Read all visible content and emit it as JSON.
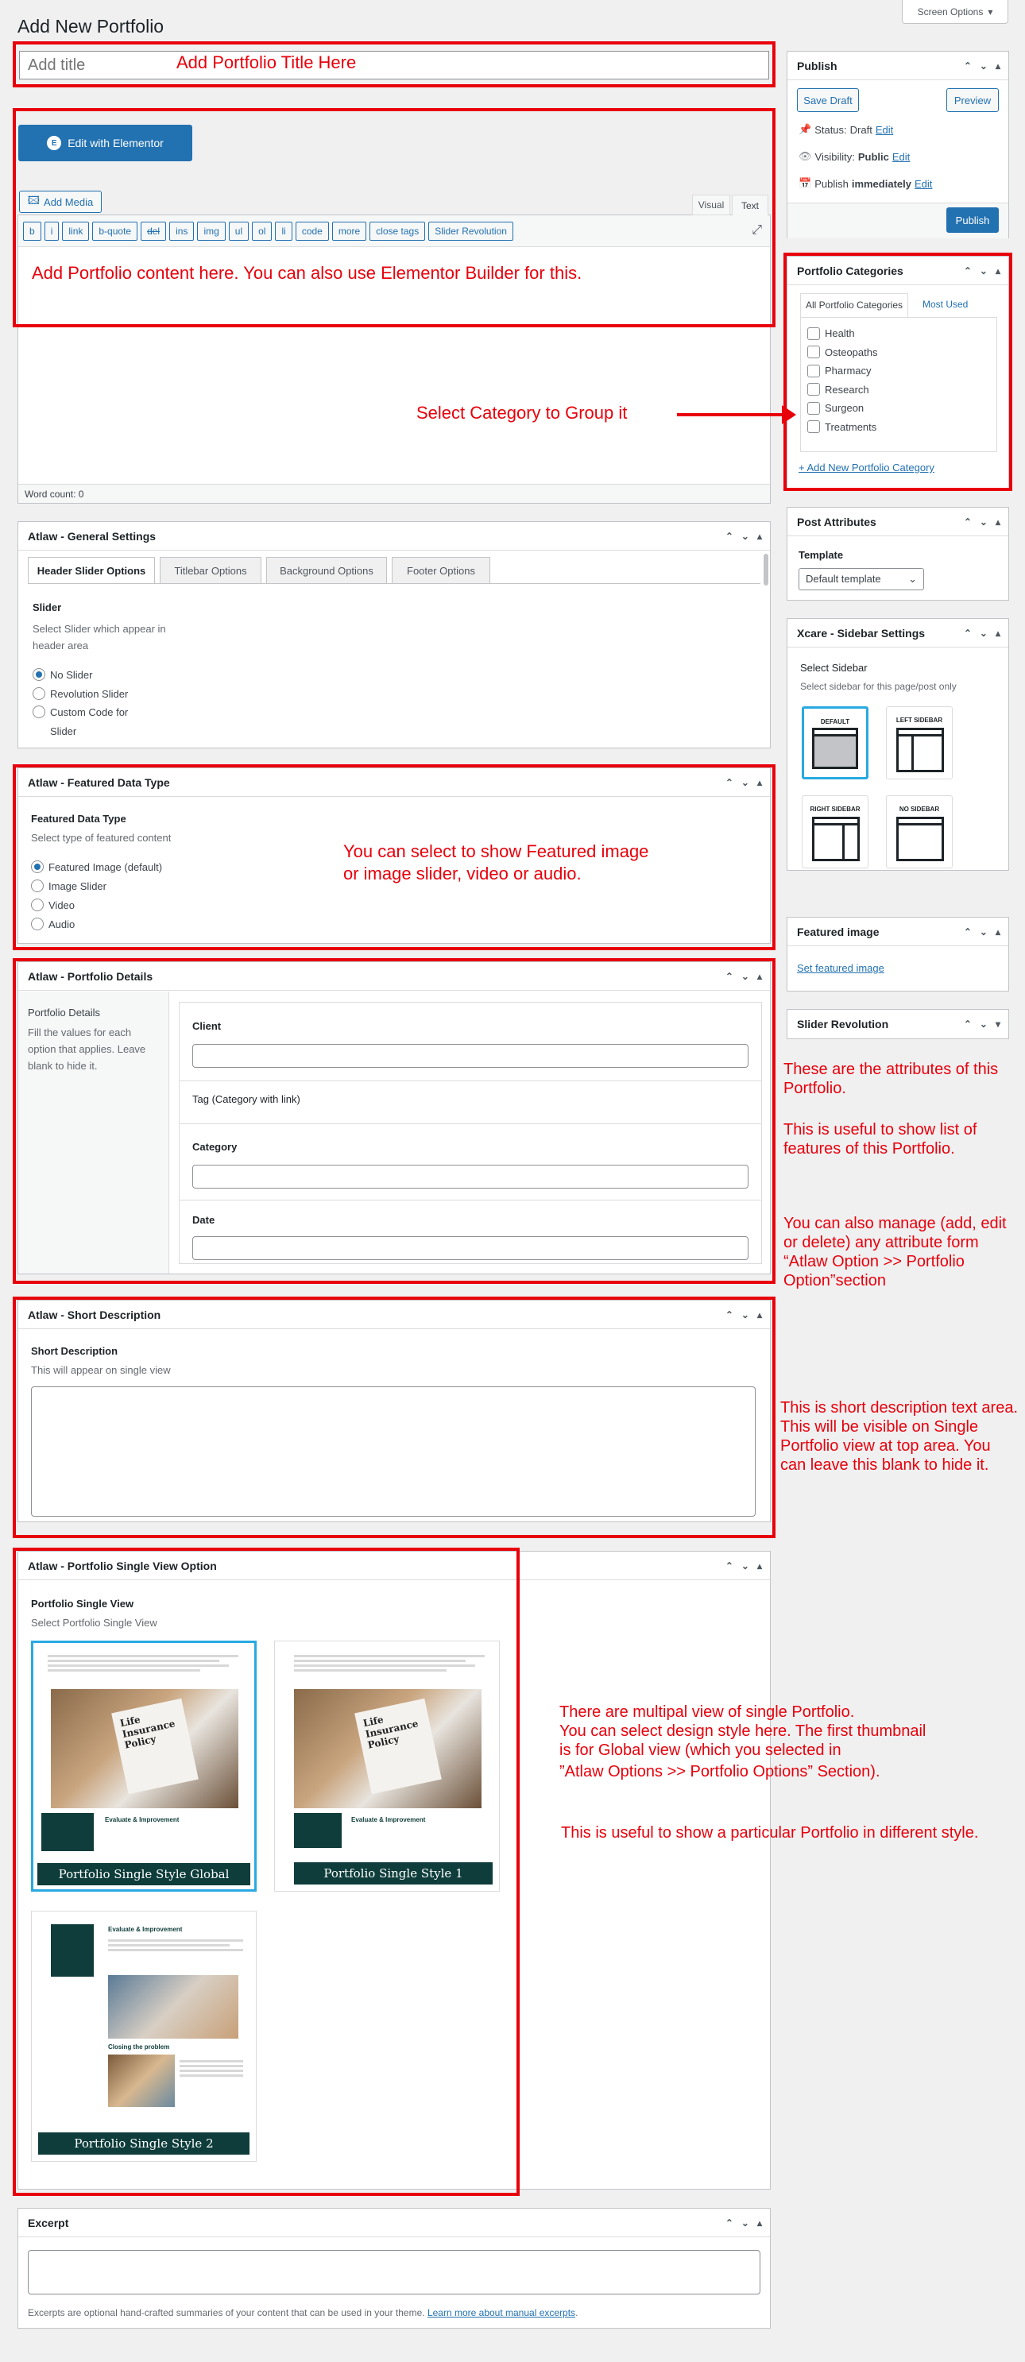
{
  "screen_options": "Screen Options",
  "page_title": "Add New Portfolio",
  "title_input": {
    "placeholder": "Add title"
  },
  "editor": {
    "elementor_button": "Edit with Elementor",
    "add_media": "Add Media",
    "tab_visual": "Visual",
    "tab_text": "Text",
    "quicktags": [
      "b",
      "i",
      "link",
      "b-quote",
      "del",
      "ins",
      "img",
      "ul",
      "ol",
      "li",
      "code",
      "more",
      "close tags",
      "Slider Revolution"
    ],
    "word_count": "Word count: 0"
  },
  "publish": {
    "title": "Publish",
    "save_draft": "Save Draft",
    "preview": "Preview",
    "status_label": "Status:",
    "status_value": "Draft",
    "visibility_label": "Visibility:",
    "visibility_value": "Public",
    "publish_label": "Publish",
    "publish_value": "immediately",
    "edit": "Edit",
    "publish_button": "Publish"
  },
  "categories": {
    "title": "Portfolio Categories",
    "tab_all": "All Portfolio Categories",
    "tab_most": "Most Used",
    "items": [
      "Health",
      "Osteopaths",
      "Pharmacy",
      "Research",
      "Surgeon",
      "Treatments"
    ],
    "add_new": "+ Add New Portfolio Category"
  },
  "post_attributes": {
    "title": "Post Attributes",
    "template_label": "Template",
    "template_value": "Default template"
  },
  "sidebar_settings": {
    "title": "Xcare - Sidebar Settings",
    "label": "Select Sidebar",
    "desc": "Select sidebar for this page/post only",
    "options": [
      "DEFAULT",
      "LEFT SIDEBAR",
      "RIGHT SIDEBAR",
      "NO SIDEBAR"
    ]
  },
  "featured_image": {
    "title": "Featured image",
    "link": "Set featured image"
  },
  "slider_revolution": {
    "title": "Slider Revolution"
  },
  "general_settings": {
    "title": "Atlaw - General Settings",
    "tabs": [
      "Header Slider Options",
      "Titlebar Options",
      "Background Options",
      "Footer Options"
    ],
    "slider_label": "Slider",
    "slider_desc": "Select Slider which appear in header area",
    "options": [
      "No Slider",
      "Revolution Slider",
      "Custom Code for Slider"
    ]
  },
  "featured_type": {
    "title": "Atlaw - Featured Data Type",
    "label": "Featured Data Type",
    "desc": "Select type of featured content",
    "options": [
      "Featured Image (default)",
      "Image Slider",
      "Video",
      "Audio"
    ]
  },
  "portfolio_details": {
    "title": "Atlaw - Portfolio Details",
    "label": "Portfolio Details",
    "desc": "Fill the values for each option that applies. Leave blank to hide it.",
    "fields": [
      "Client",
      "Tag (Category with link)",
      "Category",
      "Date"
    ]
  },
  "short_description": {
    "title": "Atlaw - Short Description",
    "label": "Short Description",
    "desc": "This will appear on single view"
  },
  "single_view": {
    "title": "Atlaw - Portfolio Single View Option",
    "label": "Portfolio Single View",
    "desc": "Select Portfolio Single View",
    "options": [
      "Portfolio Single Style Global",
      "Portfolio Single Style 1",
      "Portfolio Single Style 2"
    ]
  },
  "excerpt": {
    "title": "Excerpt",
    "desc": "Excerpts are optional hand-crafted summaries of your content that can be used in your theme.",
    "link": "Learn more about manual excerpts"
  },
  "annotations": {
    "title": "Add Portfolio Title Here",
    "content": "Add Portfolio content here. You can also use Elementor Builder for this.",
    "category": "Select Category to Group it",
    "featured_1": "You can select to show Featured image",
    "featured_2": "or image slider, video or audio.",
    "attr_1": "These are the attributes of this Portfolio.",
    "attr_2": "This is useful to show list of features of this Portfolio.",
    "attr_3": "You can also manage (add, edit or delete) any attribute form “Atlaw Option >> Portfolio Option”section",
    "short": "This is short description text area. This will be visible on Single Portfolio view at top area. You can leave this blank to hide it.",
    "single_1": "There are multipal view of single Portfolio.",
    "single_2": "You can select design style here. The first thumbnail",
    "single_3": "is for Global view (which you selected in",
    "single_4": "”Atlaw Options >> Portfolio Options” Section).",
    "single_5": "This is useful to show a particular Portfolio in different style."
  },
  "thumb_text": {
    "title": "Life Insurance Policy",
    "heading": "Evaluate & Improvement",
    "heading2": "Closing the problem"
  },
  "colors": {
    "accent": "#2271b1",
    "annotation": "#e8000b",
    "thumb_caption": "#0e3d3b"
  }
}
